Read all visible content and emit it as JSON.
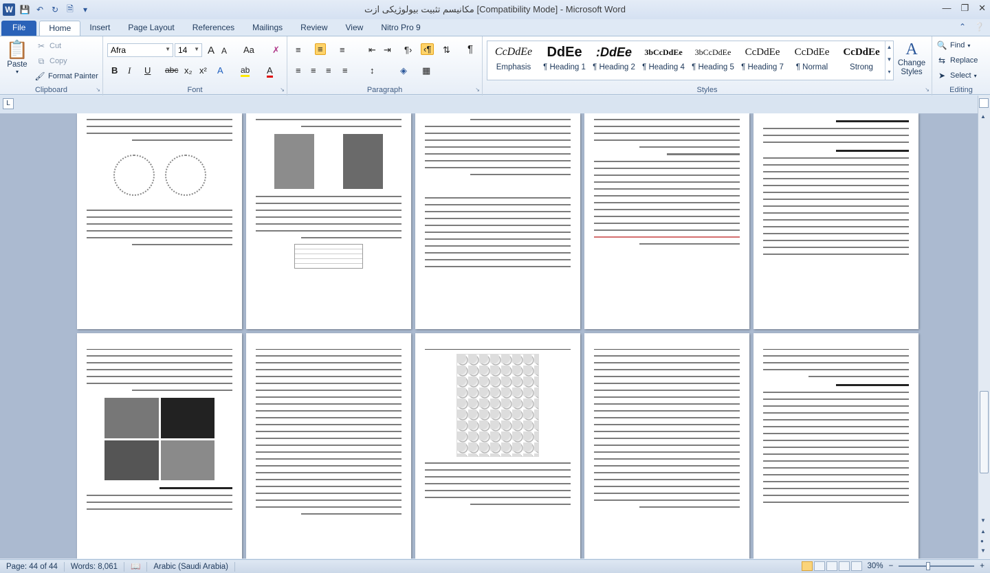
{
  "window": {
    "title": "مکانیسم تثبیت بیولوژیکی ازت [Compatibility Mode] - Microsoft Word",
    "app_logo": "W"
  },
  "quick_access": [
    "save-icon",
    "undo-icon",
    "redo-icon",
    "new-document-icon",
    "customize-icon"
  ],
  "tabs": [
    "File",
    "Home",
    "Insert",
    "Page Layout",
    "References",
    "Mailings",
    "Review",
    "View",
    "Nitro Pro 9"
  ],
  "ribbon": {
    "clipboard": {
      "label": "Clipboard",
      "paste": "Paste",
      "cut": "Cut",
      "copy": "Copy",
      "format_painter": "Format Painter"
    },
    "font": {
      "label": "Font",
      "family": "Afra",
      "size": "14",
      "bold": "B",
      "italic": "I",
      "underline": "U",
      "strike": "abc",
      "subscript": "x₂",
      "superscript": "x²",
      "grow": "A",
      "shrink": "A",
      "case": "Aa",
      "text_color": "A",
      "highlight": "ab"
    },
    "paragraph": {
      "label": "Paragraph",
      "show_marks": "¶"
    },
    "styles": {
      "label": "Styles",
      "items": [
        {
          "sample": "CcDdEe",
          "name": "Emphasis"
        },
        {
          "sample": "DdEe",
          "name": "¶ Heading 1"
        },
        {
          "sample": ":DdEe",
          "name": "¶ Heading 2"
        },
        {
          "sample": "3bCcDdEe",
          "name": "¶ Heading 4"
        },
        {
          "sample": "3bCcDdEe",
          "name": "¶ Heading 5"
        },
        {
          "sample": "CcDdEe",
          "name": "¶ Heading 7"
        },
        {
          "sample": "CcDdEe",
          "name": "¶ Normal"
        },
        {
          "sample": "CcDdEe",
          "name": "Strong"
        }
      ],
      "change_styles": "Change Styles"
    },
    "editing": {
      "label": "Editing",
      "find": "Find",
      "replace": "Replace",
      "select": "Select"
    }
  },
  "status": {
    "page": "Page: 44 of 44",
    "words": "Words: 8,061",
    "language": "Arabic (Saudi Arabia)",
    "zoom": "30%",
    "zoom_minus": "−",
    "zoom_plus": "+"
  },
  "ruler": {
    "corner": "L"
  }
}
